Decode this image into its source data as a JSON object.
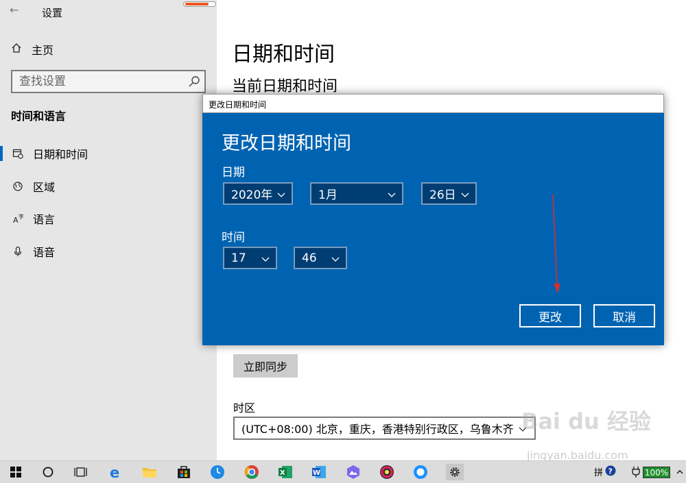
{
  "window": {
    "title": "设置",
    "back_glyph": "←"
  },
  "top_progress": {
    "fraction": 0.8,
    "color": "#e8571e"
  },
  "sidebar": {
    "home_label": "主页",
    "search_placeholder": "查找设置",
    "section_title": "时间和语言",
    "items": [
      {
        "label": "日期和时间",
        "icon": "calendar-clock-icon",
        "selected": true
      },
      {
        "label": "区域",
        "icon": "globe-icon",
        "selected": false
      },
      {
        "label": "语言",
        "icon": "language-icon",
        "selected": false
      },
      {
        "label": "语音",
        "icon": "microphone-icon",
        "selected": false
      }
    ]
  },
  "main": {
    "title": "日期和时间",
    "subtitle": "当前日期和时间",
    "sync_button": "立即同步",
    "timezone_label": "时区",
    "timezone_value": "(UTC+08:00) 北京，重庆，香港特别行政区，乌鲁木齐"
  },
  "dialog": {
    "window_title": "更改日期和时间",
    "heading": "更改日期和时间",
    "date_label": "日期",
    "year": "2020年",
    "month": "1月",
    "day": "26日",
    "time_label": "时间",
    "hour": "17",
    "minute": "46",
    "change_button": "更改",
    "cancel_button": "取消"
  },
  "taskbar": {
    "ime_label": "拼",
    "battery": "100%"
  },
  "watermark": {
    "text": "Bai du 经验",
    "sub": "jingyan.baidu.com"
  },
  "colors": {
    "accent": "#0063b1",
    "annotation_arrow": "#d32f2f",
    "battery": "#1e8e2e"
  }
}
